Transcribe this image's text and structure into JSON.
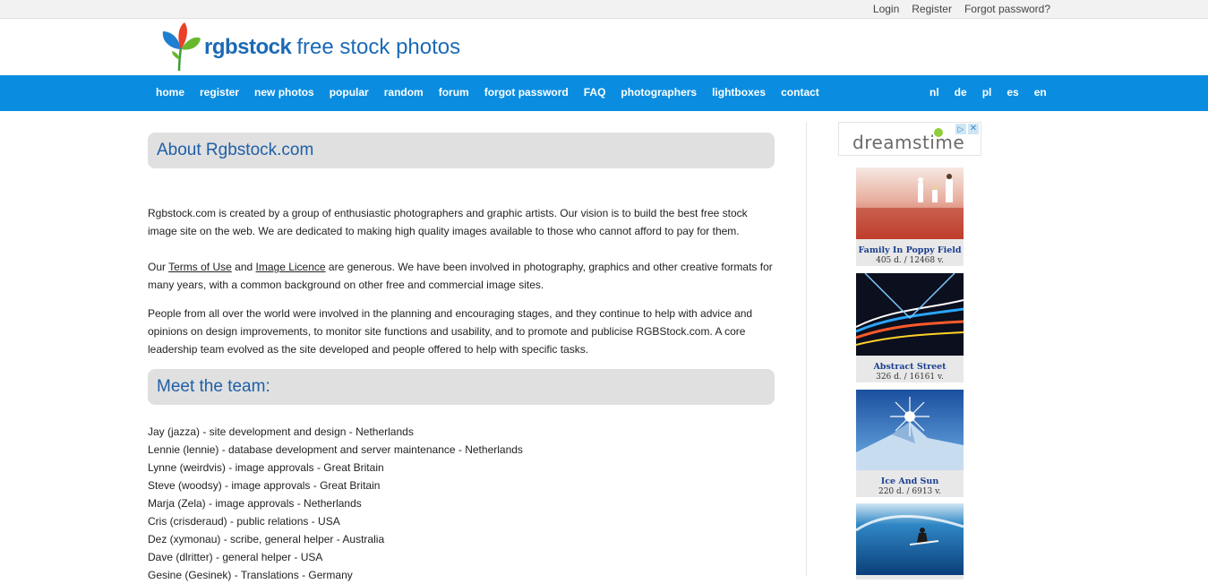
{
  "top_links": [
    "Login",
    "Register",
    "Forgot password?"
  ],
  "brand": {
    "name": "rgbstock",
    "tagline": "free stock photos"
  },
  "nav": [
    "home",
    "register",
    "new photos",
    "popular",
    "random",
    "forum",
    "forgot password",
    "FAQ",
    "photographers",
    "lightboxes",
    "contact"
  ],
  "languages": [
    "nl",
    "de",
    "pl",
    "es",
    "en"
  ],
  "about": {
    "title": "About Rgbstock.com",
    "p1": "Rgbstock.com is created by a group of enthusiastic photographers and graphic artists. Our vision is to build the best free stock image site on the web. We are dedicated to making high quality images available to those who cannot afford to pay for them.",
    "p2_prefix": "Our ",
    "p2_link1": "Terms of Use",
    "p2_and": " and ",
    "p2_link2": "Image Licence",
    "p2_rest": " are generous. We have been involved in photography, graphics and other creative formats for many years, with a common background on other free and commercial image sites.",
    "p3": "People from all over the world were involved in the planning and encouraging stages, and they continue to help with advice and opinions on design improvements, to monitor site functions and usability, and to promote and publicise RGBStock.com. A core leadership team evolved as the site developed and people offered to help with specific tasks."
  },
  "team": {
    "title": "Meet the team:",
    "members": [
      "Jay (jazza) - site development and design  - Netherlands",
      "Lennie (lennie) - database development and server maintenance - Netherlands",
      "Lynne (weirdvis) - image approvals - Great Britain",
      "Steve (woodsy) - image approvals - Great Britain",
      "Marja (Zela) - image approvals - Netherlands",
      "Cris (crisderaud) - public relations - USA",
      "Dez (xymonau) - scribe, general helper - Australia",
      "Dave (dlritter) - general helper - USA",
      "Gesine (Gesinek) - Translations - Germany"
    ]
  },
  "sidebar": {
    "ad_brand": "dreamstime",
    "ad_icons": [
      "info-icon",
      "close-icon"
    ],
    "thumbs": [
      {
        "caption": "Family In Poppy Field",
        "stats": "405 d. / 12468 v."
      },
      {
        "caption": "Abstract Street",
        "stats": "326 d. / 16161 v."
      },
      {
        "caption": "Ice And Sun",
        "stats": "220 d. / 6913 v."
      },
      {
        "caption": "",
        "stats": ""
      }
    ]
  },
  "colors": {
    "nav_bg": "#0a8de0",
    "title_blue": "#1f5fa8",
    "section_bg": "#e0e0e0"
  }
}
